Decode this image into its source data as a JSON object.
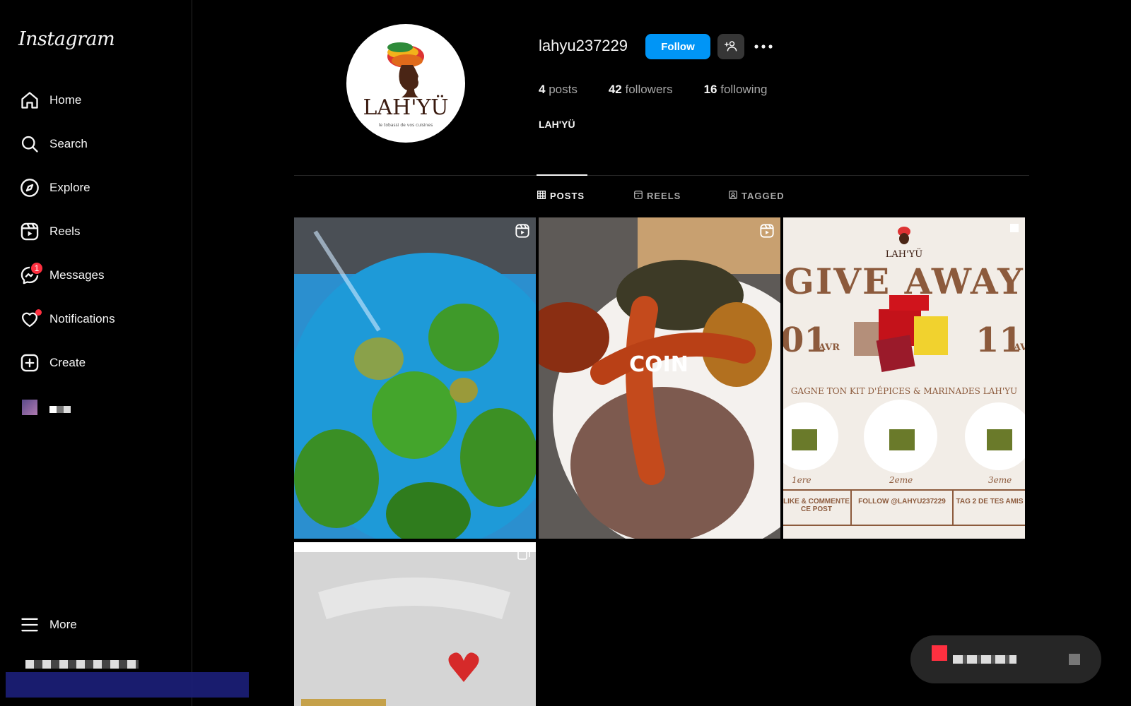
{
  "app": {
    "logo": "Instagram"
  },
  "sidebar": {
    "items": [
      {
        "label": "Home",
        "icon": "home-icon"
      },
      {
        "label": "Search",
        "icon": "search-icon"
      },
      {
        "label": "Explore",
        "icon": "compass-icon"
      },
      {
        "label": "Reels",
        "icon": "reels-icon"
      },
      {
        "label": "Messages",
        "icon": "messenger-icon",
        "badge": "1"
      },
      {
        "label": "Notifications",
        "icon": "heart-icon"
      },
      {
        "label": "Create",
        "icon": "plus-square-icon"
      }
    ],
    "more_label": "More"
  },
  "profile": {
    "username": "lahyu237229",
    "follow_label": "Follow",
    "posts_count": "4",
    "posts_label": "posts",
    "followers_count": "42",
    "followers_label": "followers",
    "following_count": "16",
    "following_label": "following",
    "full_name": "LAH'YÜ",
    "avatar_text": "LAH'YÜ",
    "avatar_tagline": "le tobassi de vos cuisines"
  },
  "tabs": [
    {
      "label": "POSTS",
      "icon": "grid-icon",
      "active": true
    },
    {
      "label": "REELS",
      "icon": "reels-icon",
      "active": false
    },
    {
      "label": "TAGGED",
      "icon": "tag-person-icon",
      "active": false
    }
  ],
  "posts": [
    {
      "type": "reel",
      "content": "green peppers in blue colander"
    },
    {
      "type": "reel",
      "overlay_text": "COIN"
    },
    {
      "type": "image",
      "brand": "LAH'YÜ",
      "title": "GIVE AWAY",
      "date_left": "01",
      "date_left_month": "AVR",
      "date_right": "11",
      "date_right_month": "AVR",
      "subtitle": "GAGNE TON KIT D'ÉPICES & MARINADES LAH'YU",
      "prizes": [
        "1ere",
        "2eme",
        "3eme"
      ],
      "steps": [
        "LIKE & COMMENTE CE POST",
        "FOLLOW @LAHYU237229",
        "TAG 2 DE TES AMIS"
      ]
    },
    {
      "type": "carousel",
      "content": "jar with heart label"
    }
  ],
  "colors": {
    "accent": "#0095f6",
    "notify": "#ff3040",
    "background": "#000000"
  }
}
